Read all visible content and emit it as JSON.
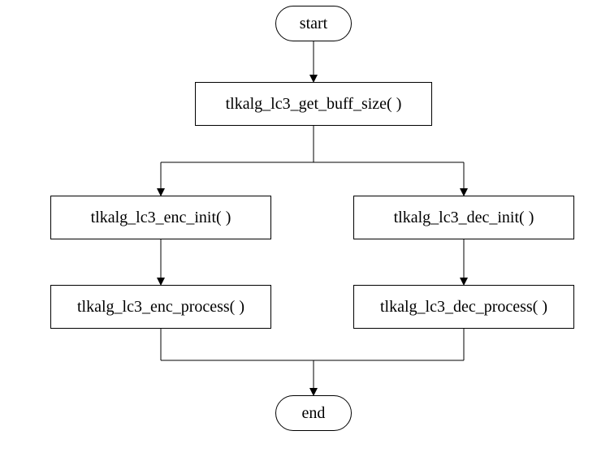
{
  "nodes": {
    "start": "start",
    "buff": "tlkalg_lc3_get_buff_size( )",
    "enc_init": "tlkalg_lc3_enc_init( )",
    "dec_init": "tlkalg_lc3_dec_init( )",
    "enc_proc": "tlkalg_lc3_enc_process( )",
    "dec_proc": "tlkalg_lc3_dec_process( )",
    "end": "end"
  }
}
